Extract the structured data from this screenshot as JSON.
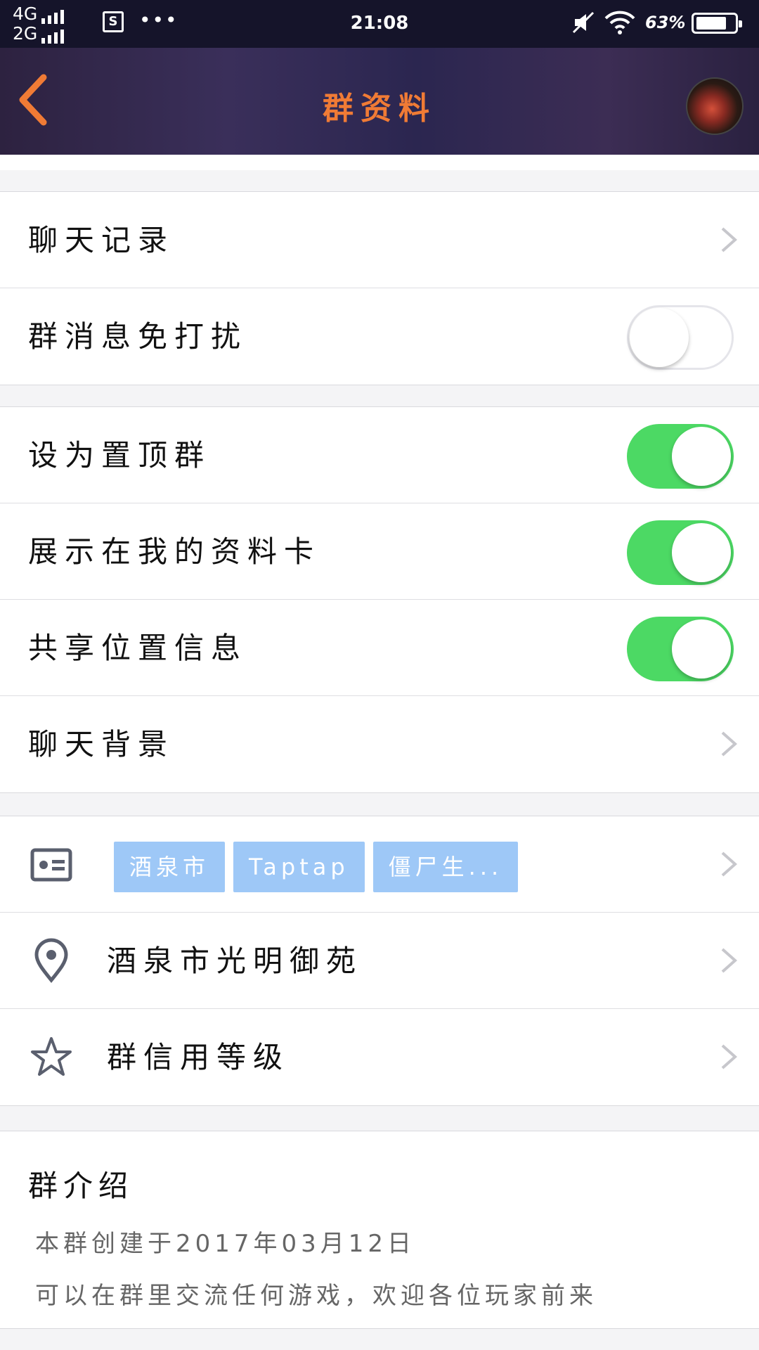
{
  "status_bar": {
    "net1": "4G",
    "net2": "2G",
    "dots": "•••",
    "time": "21:08",
    "battery": "63"
  },
  "header": {
    "title": "群资料",
    "accent_color": "#f07b35"
  },
  "group1": {
    "chat_history": "聊天记录",
    "dnd": "群消息免打扰",
    "dnd_on": false
  },
  "group2": {
    "pin": "设为置顶群",
    "pin_on": true,
    "show_card": "展示在我的资料卡",
    "show_card_on": true,
    "share_location": "共享位置信息",
    "share_location_on": true,
    "chat_bg": "聊天背景"
  },
  "group3": {
    "tags": [
      "酒泉市",
      "Taptap",
      "僵尸生..."
    ],
    "location": "酒泉市光明御苑",
    "credit": "群信用等级",
    "icons": [
      "id-card-icon",
      "location-pin-icon",
      "star-icon"
    ]
  },
  "intro": {
    "heading": "群介绍",
    "line1": "本群创建于2017年03月12日",
    "line2": "可以在群里交流任何游戏，欢迎各位玩家前来"
  },
  "colors": {
    "toggle_on": "#4cd964",
    "tag_bg": "#9ec8f7"
  }
}
